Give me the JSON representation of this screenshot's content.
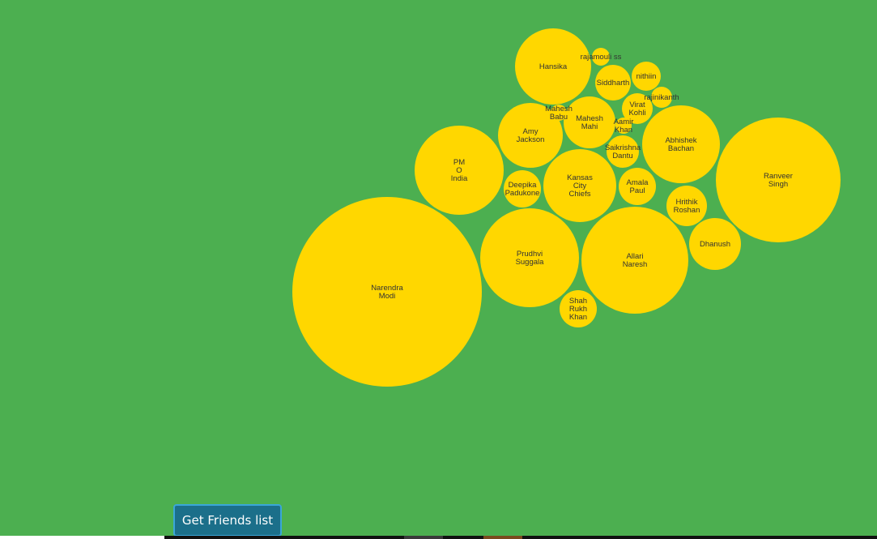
{
  "actions": {
    "get_friends_label": "Get Friends list"
  },
  "colors": {
    "background": "#4caf50",
    "bubble_fill": "#ffd700",
    "label_color": "#333333",
    "button_background": "#1b6f8a",
    "button_border": "#3aa6d8"
  },
  "bubbles": [
    {
      "lines": [
        "Narendra",
        "Modi"
      ]
    },
    {
      "lines": [
        "Ranveer",
        "Singh"
      ]
    },
    {
      "lines": [
        "Allari",
        "Naresh"
      ]
    },
    {
      "lines": [
        "Prudhvi",
        "Suggala"
      ]
    },
    {
      "lines": [
        "PM",
        "O",
        "India"
      ]
    },
    {
      "lines": [
        "Abhishek",
        "Bachan"
      ]
    },
    {
      "lines": [
        "Kansas",
        "City",
        "Chiefs"
      ]
    },
    {
      "lines": [
        "Hansika"
      ]
    },
    {
      "lines": [
        "Amy",
        "Jackson"
      ]
    },
    {
      "lines": [
        "Mahesh",
        "Mahi"
      ]
    },
    {
      "lines": [
        "Dhanush"
      ]
    },
    {
      "lines": [
        "Hrithik",
        "Roshan"
      ]
    },
    {
      "lines": [
        "Amala",
        "Paul"
      ]
    },
    {
      "lines": [
        "Shah",
        "Rukh",
        "Khan"
      ]
    },
    {
      "lines": [
        "Deepika",
        "Padukone"
      ]
    },
    {
      "lines": [
        "Siddharth"
      ]
    },
    {
      "lines": [
        "Saikrishna",
        "Dantu"
      ]
    },
    {
      "lines": [
        "Virat",
        "Kohli"
      ]
    },
    {
      "lines": [
        "nithiin"
      ]
    },
    {
      "lines": [
        "Mahesh",
        "Babu"
      ]
    },
    {
      "lines": [
        "Aamir",
        "Khan"
      ]
    },
    {
      "lines": [
        "rajinikanth"
      ]
    },
    {
      "lines": [
        "rajamouli ss"
      ]
    }
  ]
}
